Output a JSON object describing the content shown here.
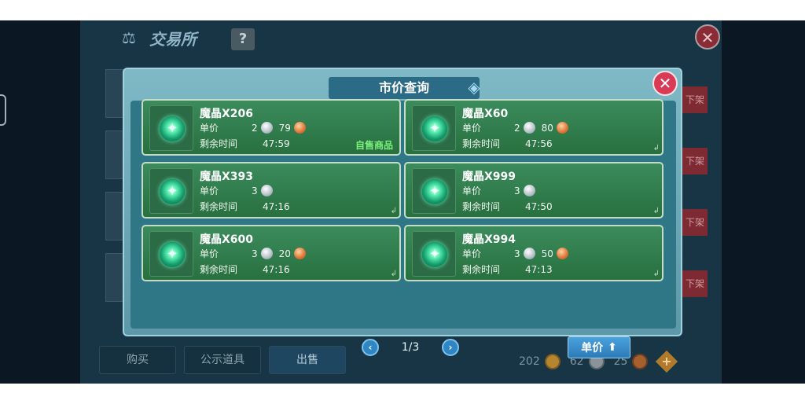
{
  "background": {
    "title": "交易所",
    "help": "?",
    "close": "✕",
    "shelf_label": "下架",
    "bottom_buttons": [
      "购买",
      "公示道具",
      "出售"
    ],
    "currency": {
      "gold": "202",
      "silver": "62",
      "copper": "25"
    }
  },
  "dialog": {
    "title": "市价查询",
    "close": "✕",
    "price_label": "单价",
    "time_label": "剩余时间",
    "self_tag": "自售商品",
    "items": [
      {
        "name": "魔晶X206",
        "silver": "2",
        "copper": "79",
        "time": "47:59",
        "self": true
      },
      {
        "name": "魔晶X60",
        "silver": "2",
        "copper": "80",
        "time": "47:56",
        "self": false
      },
      {
        "name": "魔晶X393",
        "silver": "3",
        "copper": "",
        "time": "47:16",
        "self": false
      },
      {
        "name": "魔晶X999",
        "silver": "3",
        "copper": "",
        "time": "47:50",
        "self": false
      },
      {
        "name": "魔晶X600",
        "silver": "3",
        "copper": "20",
        "time": "47:16",
        "self": false
      },
      {
        "name": "魔晶X994",
        "silver": "3",
        "copper": "50",
        "time": "47:13",
        "self": false
      }
    ],
    "pager": {
      "prev": "‹",
      "text": "1/3",
      "next": "›"
    },
    "sort_label": "单价"
  }
}
